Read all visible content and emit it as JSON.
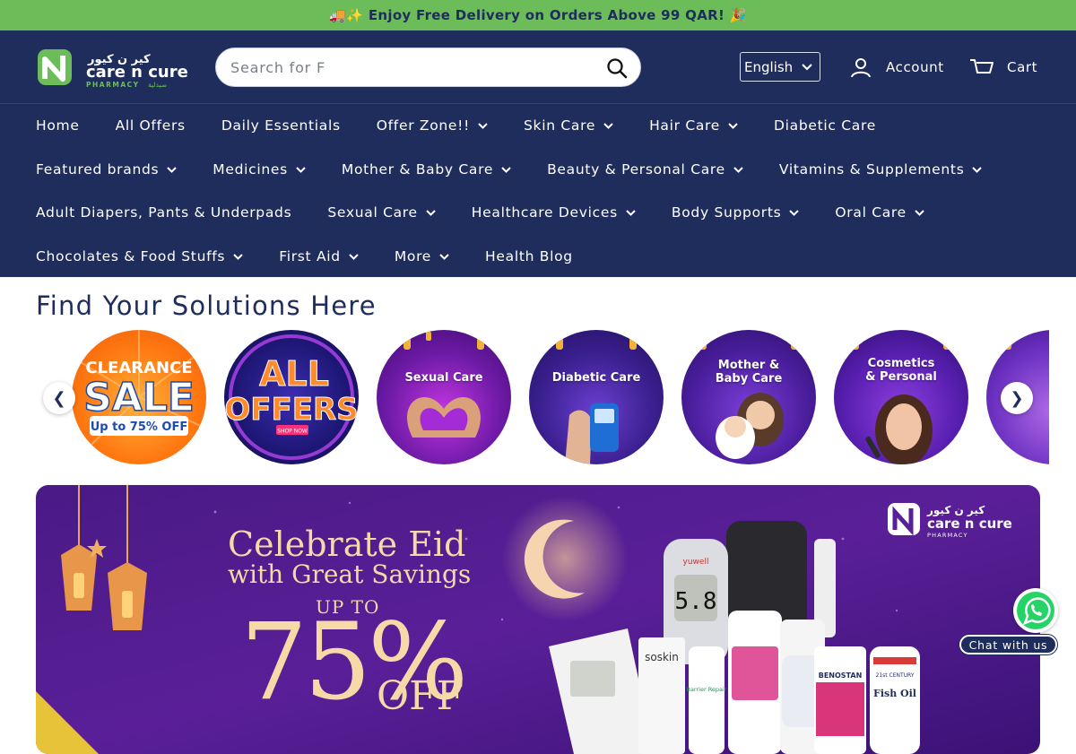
{
  "announcement": "🚚✨ Enjoy Free Delivery on Orders Above 99 QAR! 🎉",
  "header": {
    "logo_en": "care n cure",
    "logo_ar": "كير ن كيور",
    "logo_sub": "PHARMACY",
    "logo_sub_ar": "صيدلية",
    "search_value": "",
    "search_placeholder": "Search for F",
    "language": "English",
    "account_label": "Account",
    "cart_label": "Cart"
  },
  "nav": {
    "rows": [
      [
        {
          "label": "Home",
          "dropdown": false
        },
        {
          "label": "All Offers",
          "dropdown": false
        },
        {
          "label": "Daily Essentials",
          "dropdown": false
        },
        {
          "label": "Offer Zone!!",
          "dropdown": true
        },
        {
          "label": "Skin Care",
          "dropdown": true
        },
        {
          "label": "Hair Care",
          "dropdown": true
        },
        {
          "label": "Diabetic Care",
          "dropdown": false
        }
      ],
      [
        {
          "label": "Featured brands",
          "dropdown": true
        },
        {
          "label": "Medicines",
          "dropdown": true
        },
        {
          "label": "Mother & Baby Care",
          "dropdown": true
        },
        {
          "label": "Beauty & Personal Care",
          "dropdown": true
        },
        {
          "label": "Vitamins & Supplements",
          "dropdown": true
        }
      ],
      [
        {
          "label": "Adult Diapers, Pants & Underpads",
          "dropdown": false
        },
        {
          "label": "Sexual Care",
          "dropdown": true
        },
        {
          "label": "Healthcare Devices",
          "dropdown": true
        },
        {
          "label": "Body Supports",
          "dropdown": true
        },
        {
          "label": "Oral Care",
          "dropdown": true
        }
      ],
      [
        {
          "label": "Chocolates & Food Stuffs",
          "dropdown": true
        },
        {
          "label": "First Aid",
          "dropdown": true
        },
        {
          "label": "More",
          "dropdown": true
        },
        {
          "label": "Health Blog",
          "dropdown": false
        }
      ]
    ]
  },
  "section_title": "Find Your Solutions Here",
  "categories": [
    {
      "line1": "CLEARANCE",
      "line2": "SALE",
      "line3": "Up to 75% OFF"
    },
    {
      "line1": "ALL",
      "line2": "OFFERS",
      "line3": "SHOP NOW"
    },
    {
      "label": "Sexual Care"
    },
    {
      "label": "Diabetic Care"
    },
    {
      "label": "Mother & Baby Care"
    },
    {
      "label": "Cosmetics & Personal"
    },
    {
      "label": ""
    }
  ],
  "carousel": {
    "prev": "❮",
    "next": "❯"
  },
  "banner": {
    "headline": "Celebrate Eid",
    "subline": "with Great Savings",
    "up_to": "UP TO",
    "percent": "75%",
    "off": "OFF",
    "logo_en": "care n cure",
    "logo_ar": "كير ن كيور",
    "logo_sub": "PHARMACY",
    "product_labels": [
      "yuwell",
      "5.8",
      "soskin",
      "Barrier Repair",
      "BENOSTAN",
      "Fish Oil",
      "21st CENTURY"
    ]
  },
  "whatsapp": {
    "label": "Chat with us"
  },
  "colors": {
    "navy": "#1f2d5c",
    "green": "#6cbd5a",
    "banner_purple": "#5a1f8e",
    "gold": "#f7d9a8"
  }
}
